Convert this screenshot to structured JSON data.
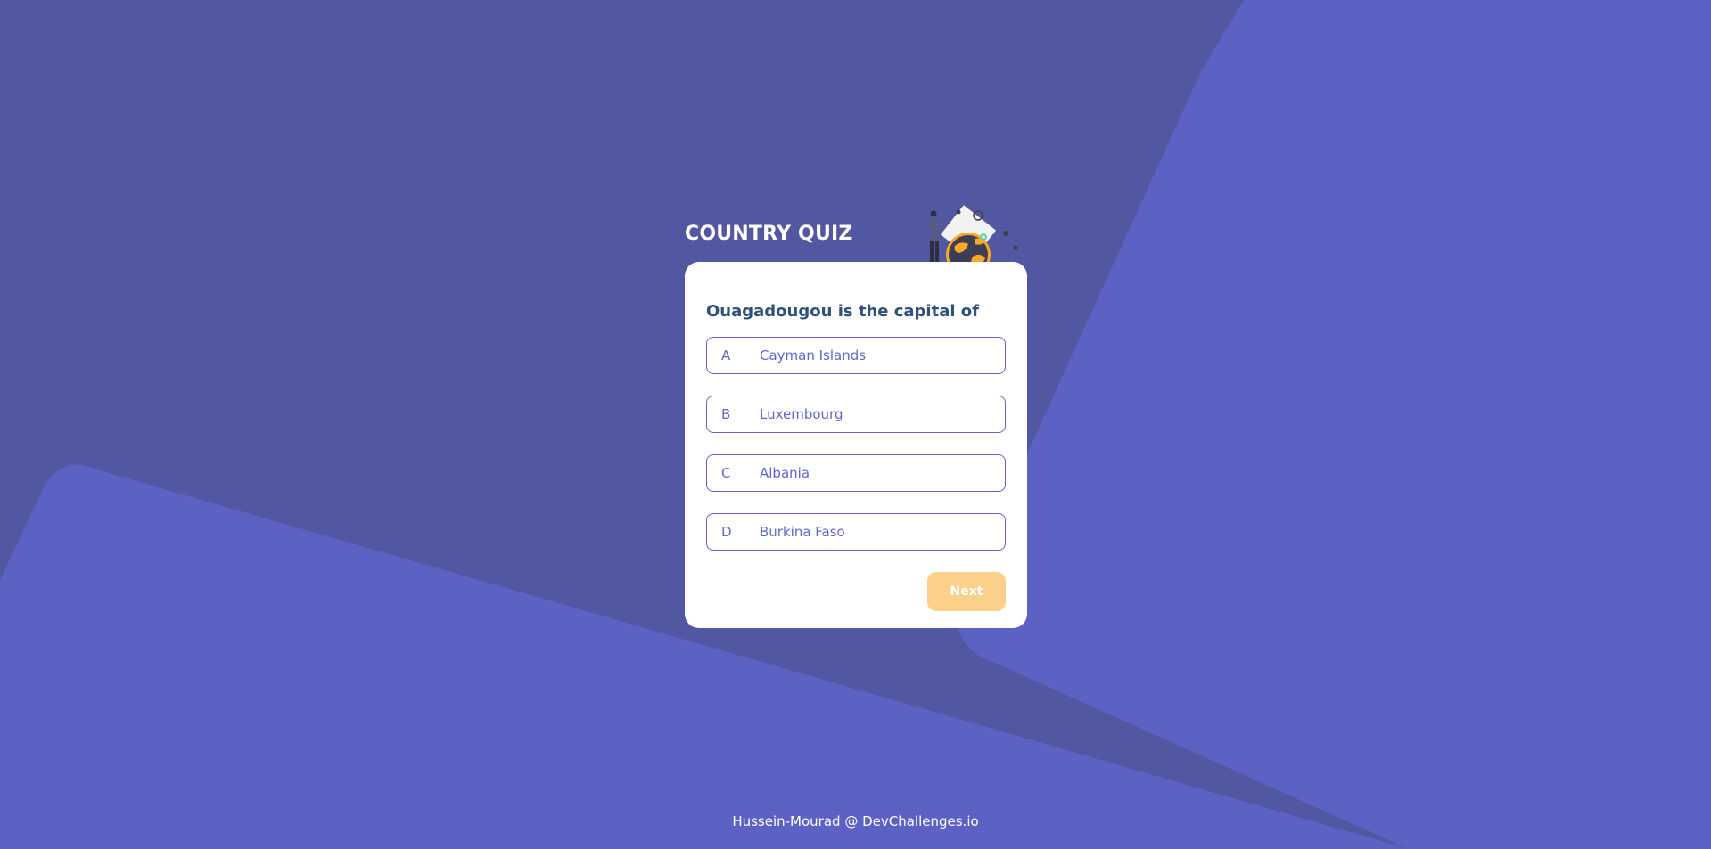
{
  "app": {
    "title": "COUNTRY QUIZ"
  },
  "quiz": {
    "question": "Ouagadougou is the capital of",
    "options": [
      {
        "letter": "A",
        "text": "Cayman Islands"
      },
      {
        "letter": "B",
        "text": "Luxembourg"
      },
      {
        "letter": "C",
        "text": "Albania"
      },
      {
        "letter": "D",
        "text": "Burkina Faso"
      }
    ],
    "next_label": "Next"
  },
  "footer": {
    "credit": "Hussein-Mourad @ DevChallenges.io"
  },
  "colors": {
    "background": "#5157a0",
    "background_shapes": "#5c62c4",
    "card": "#ffffff",
    "title": "#ffffff",
    "question": "#2f527b",
    "option_border": "#6066d0",
    "option_text": "#6066d0",
    "next_button": "#fbd08b"
  },
  "icons": {
    "illustration": "traveler-with-globe-illustration"
  }
}
